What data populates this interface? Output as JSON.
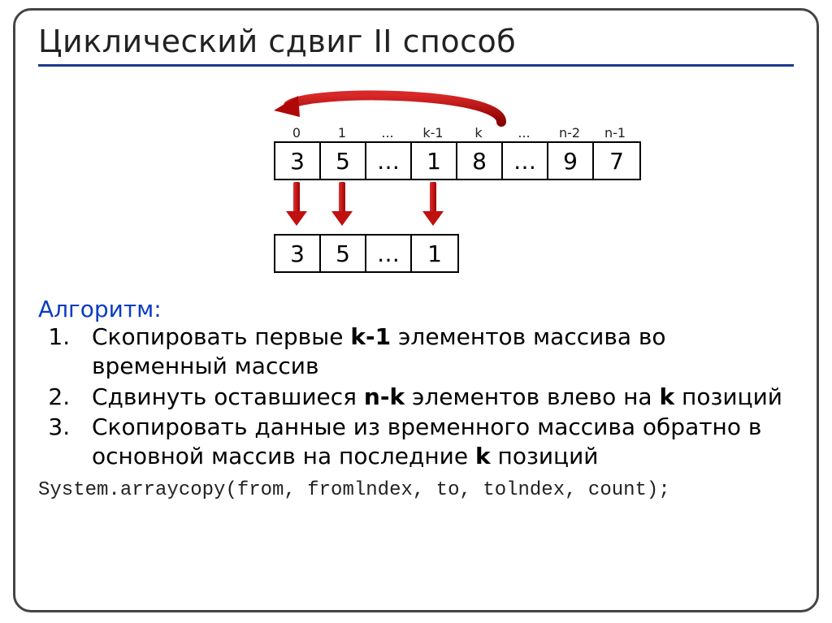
{
  "title": "Циклический сдвиг II способ",
  "diagram": {
    "indices": [
      "0",
      "1",
      "...",
      "k-1",
      "k",
      "...",
      "n-2",
      "n-1"
    ],
    "top_row": [
      "3",
      "5",
      "…",
      "1",
      "8",
      "…",
      "9",
      "7"
    ],
    "bottom_row": [
      "3",
      "5",
      "…",
      "1"
    ]
  },
  "algo_label": "Алгоритм:",
  "steps": {
    "s1a": "Скопировать первые ",
    "s1b": "k-1",
    "s1c": " элементов массива во временный массив",
    "s2a": "Сдвинуть оставшиеся ",
    "s2b": "n-k",
    "s2c": " элементов влево на ",
    "s2d": "k",
    "s2e": " позиций",
    "s3a": "Скопировать данные из временного массива обратно в основной массив на последние ",
    "s3b": "k",
    "s3c": " позиций"
  },
  "code": "System.arraycopy(from, fromlndex, to, tolndex, count);"
}
